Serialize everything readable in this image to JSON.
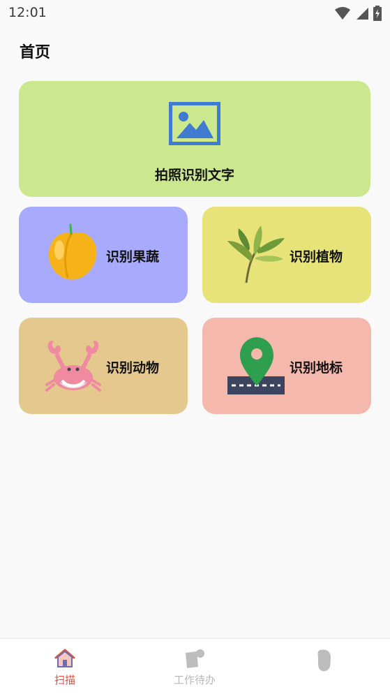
{
  "status_bar": {
    "time": "12:01",
    "icons": [
      "wifi-icon",
      "cell-signal-icon",
      "battery-charging-icon"
    ]
  },
  "header": {
    "title": "首页"
  },
  "cards": {
    "ocr": {
      "label": "拍照识别文字",
      "icon": "image-icon",
      "color": "#cbe88e"
    },
    "fruit": {
      "label": "识别果蔬",
      "icon": "peach-icon",
      "color": "#a8abfd"
    },
    "plant": {
      "label": "识别植物",
      "icon": "leaf-icon",
      "color": "#e7e379"
    },
    "animal": {
      "label": "识别动物",
      "icon": "crab-icon",
      "color": "#e4c88e"
    },
    "landmark": {
      "label": "识别地标",
      "icon": "map-pin-icon",
      "color": "#f4b8ad"
    }
  },
  "tab_bar": {
    "tabs": [
      {
        "label": "扫描",
        "icon": "home-icon",
        "active": true
      },
      {
        "label": "工作待办",
        "icon": "todo-icon",
        "active": false
      },
      {
        "label": "",
        "icon": "profile-icon",
        "active": false
      }
    ],
    "active_color": "#e04b3a",
    "inactive_color": "#b8b8b8"
  }
}
